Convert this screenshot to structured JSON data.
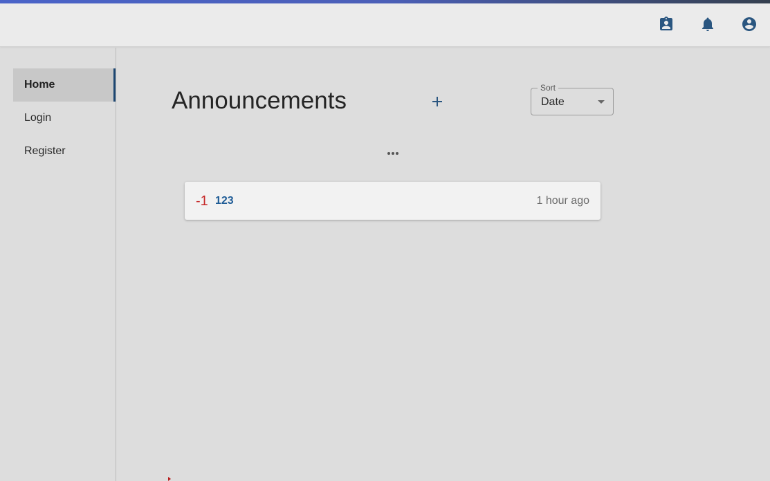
{
  "header": {
    "icons": [
      "assignment-icon",
      "notifications-icon",
      "account-circle-icon"
    ],
    "accent_color": "#1d4772"
  },
  "sidebar": {
    "items": [
      {
        "label": "Home",
        "active": true
      },
      {
        "label": "Login",
        "active": false
      },
      {
        "label": "Register",
        "active": false
      }
    ]
  },
  "main": {
    "title": "Announcements",
    "add_icon": "plus-icon",
    "sort": {
      "label": "Sort",
      "value": "Date"
    },
    "more_icon": "more-horizontal-icon",
    "announcements": [
      {
        "score": "-1",
        "title": "123",
        "time": "1 hour ago"
      }
    ]
  }
}
